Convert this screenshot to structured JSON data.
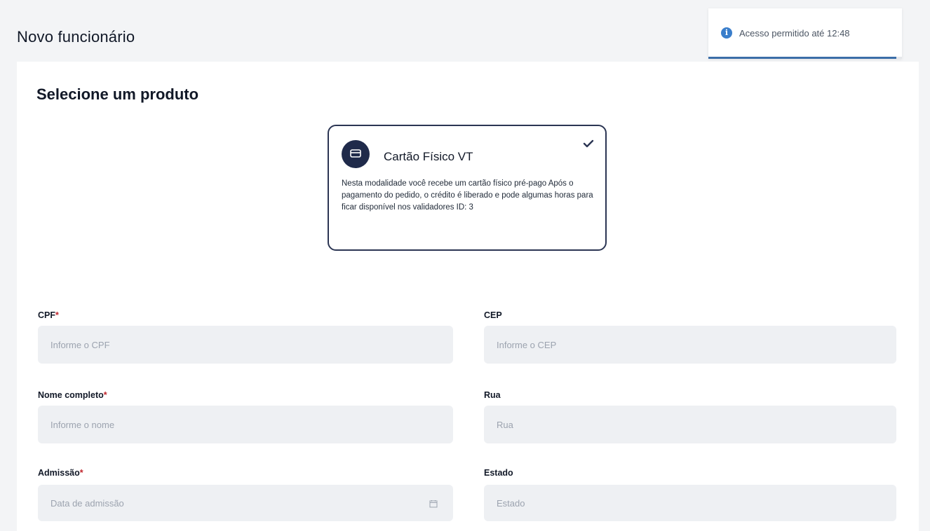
{
  "page": {
    "title": "Novo funcionário"
  },
  "toast": {
    "icon": "info-icon",
    "text": "Acesso permitido até 12:48",
    "progress": 0.97,
    "color": "#3b6ea8"
  },
  "product_section": {
    "title": "Selecione um produto",
    "product": {
      "name": "Cartão Físico VT",
      "description": "Nesta modalidade você recebe um cartão físico pré-pago Após o pagamento do pedido, o crédito é liberado e pode algumas horas para ficar disponível nos validadores  ID: 3",
      "selected": true,
      "icon": "card-icon",
      "check_icon": "check-icon"
    }
  },
  "form": {
    "cpf": {
      "label": "CPF",
      "required_mark": "*",
      "placeholder": "Informe o CPF",
      "value": ""
    },
    "cep": {
      "label": "CEP",
      "placeholder": "Informe o CEP",
      "value": ""
    },
    "nome": {
      "label": "Nome completo",
      "required_mark": "*",
      "placeholder": "Informe o nome",
      "value": ""
    },
    "rua": {
      "label": "Rua",
      "placeholder": "Rua",
      "value": ""
    },
    "admissao": {
      "label": "Admissão",
      "required_mark": "*",
      "placeholder": "Data de admissão",
      "value": "",
      "icon": "calendar-icon"
    },
    "estado": {
      "label": "Estado",
      "placeholder": "Estado",
      "value": ""
    }
  },
  "colors": {
    "accent": "#1f2a4a",
    "required": "#c0262d",
    "input_bg": "#eef0f3"
  }
}
